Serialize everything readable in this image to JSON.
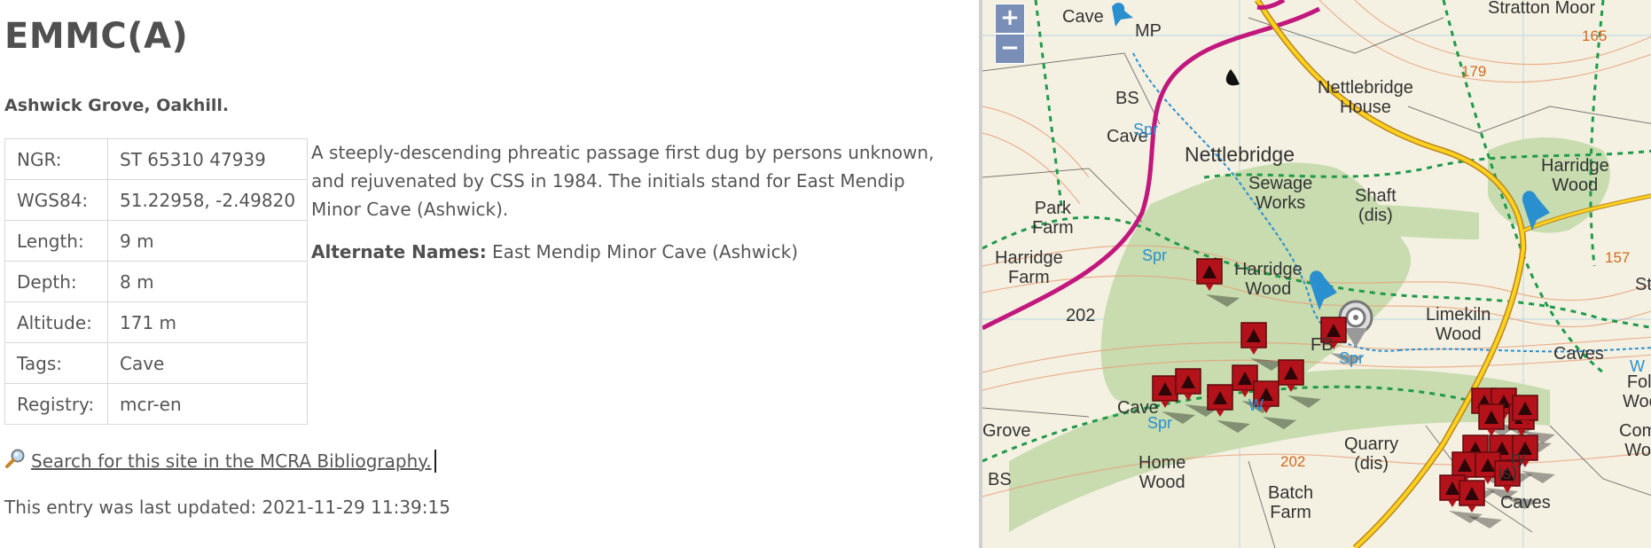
{
  "site": {
    "title": "EMMC(A)",
    "location": "Ashwick Grove, Oakhill."
  },
  "info_rows": [
    {
      "label": "NGR:",
      "value": "ST 65310 47939"
    },
    {
      "label": "WGS84:",
      "value": "51.22958, -2.49820"
    },
    {
      "label": "Length:",
      "value": "9 m"
    },
    {
      "label": "Depth:",
      "value": "8 m"
    },
    {
      "label": "Altitude:",
      "value": "171 m"
    },
    {
      "label": "Tags:",
      "value": "Cave"
    },
    {
      "label": "Registry:",
      "value": "mcr-en"
    }
  ],
  "description": "A steeply-descending phreatic passage first dug by persons unknown, and rejuvenated by CSS in 1984. The initials stand for East Mendip Minor Cave (Ashwick).",
  "alternate_names": {
    "label": "Alternate Names:",
    "value": "East Mendip Minor Cave (Ashwick)"
  },
  "search_link": {
    "icon": "magnifier-icon",
    "text": "Search for this site in the MCRA Bibliography."
  },
  "last_updated": "This entry was last updated: 2021-11-29 11:39:15",
  "map": {
    "zoom_in": "+",
    "zoom_out": "−",
    "labels": {
      "cave1": "Cave",
      "mp": "MP",
      "bs1": "BS",
      "cave2": "Cave",
      "spr1": "Spr",
      "nettlebridge_house": "Nettlebridge\nHouse",
      "nettlebridge": "Nettlebridge",
      "sewage": "Sewage\nWorks",
      "shaft": "Shaft\n(dis)",
      "stratton": "Stratton Moor",
      "n165": "165",
      "n179": "179",
      "harridge_wood_e": "Harridge\nWood",
      "park_farm": "Park\nFarm",
      "harridge_farm": "Harridge\nFarm",
      "spr2": "Spr",
      "harridge_wood": "Harridge\nWood",
      "n202a": "202",
      "fb": "FB",
      "spr3": "Spr",
      "limekiln": "Limekiln\nWood",
      "caves1": "Caves",
      "n157": "157",
      "sto": "Sto",
      "folly": "Folly\nWood",
      "cave3": "Cave",
      "spr4": "Spr",
      "grove": "Grove",
      "quarry": "Quarry\n(dis)",
      "n202b": "202",
      "combe": "Combe\nWood",
      "home_wood": "Home\nWood",
      "batch_farm": "Batch\nFarm",
      "caves2": "Caves",
      "bs2": "BS",
      "ry": "ry",
      "is": "is)",
      "w": "W",
      "w2": "W"
    }
  }
}
